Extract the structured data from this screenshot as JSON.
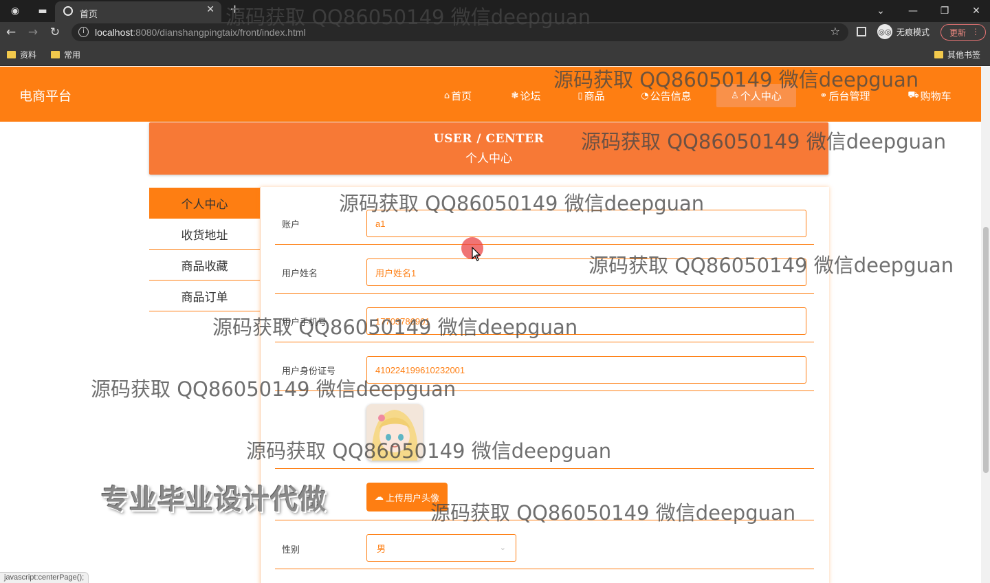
{
  "browser": {
    "tab_title": "首页",
    "url_host": "localhost",
    "url_rest": ":8080/dianshangpingtaix/front/index.html",
    "incognito_label": "无痕模式",
    "update_label": "更新",
    "bookmarks": [
      "资料",
      "常用"
    ],
    "other_bookmarks": "其他书签",
    "status_text": "javascript:centerPage();"
  },
  "header": {
    "brand": "电商平台",
    "nav": [
      {
        "label": "首页",
        "icon": "home-icon"
      },
      {
        "label": "论坛",
        "icon": "forum-icon"
      },
      {
        "label": "商品",
        "icon": "goods-icon"
      },
      {
        "label": "公告信息",
        "icon": "notice-icon"
      },
      {
        "label": "个人中心",
        "icon": "user-icon"
      },
      {
        "label": "后台管理",
        "icon": "link-icon"
      },
      {
        "label": "购物车",
        "icon": "cart-icon"
      }
    ],
    "colors": {
      "primary": "#fe7e12",
      "banner": "#f77936"
    }
  },
  "banner": {
    "en": "USER / CENTER",
    "zh": "个人中心"
  },
  "sidebar": {
    "items": [
      "个人中心",
      "收货地址",
      "商品收藏",
      "商品订单"
    ]
  },
  "form": {
    "account_label": "账户",
    "account_value": "a1",
    "name_label": "用户姓名",
    "name_value": "用户姓名1",
    "phone_label": "用户手机号",
    "phone_value": "17703786901",
    "idcard_label": "用户身份证号",
    "idcard_value": "410224199610232001",
    "upload_label": "上传用户头像",
    "gender_label": "性别",
    "gender_value": "男"
  },
  "overlay": {
    "watermark": "源码获取 QQ86050149 微信deepguan",
    "promo": "专业毕业设计代做"
  }
}
